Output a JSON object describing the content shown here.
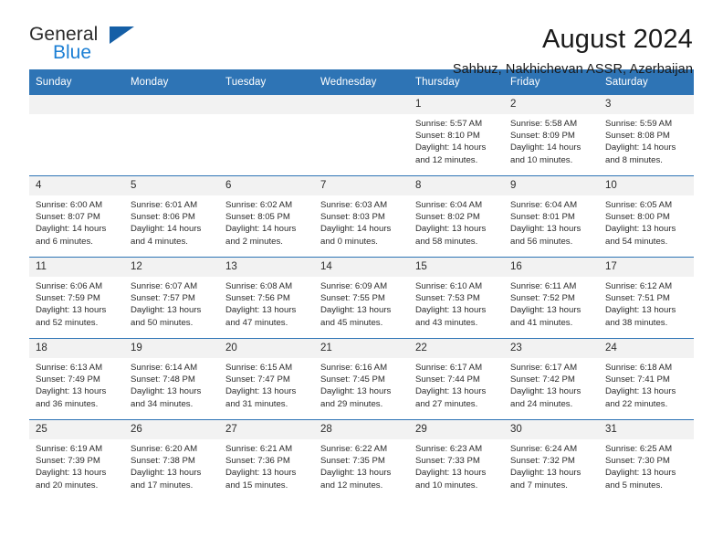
{
  "brand": {
    "name_top": "General",
    "name_bottom": "Blue",
    "triangle_color": "#155fa6",
    "blue_color": "#1c7fd4"
  },
  "header": {
    "month_title": "August 2024",
    "location": "Sahbuz, Nakhichevan ASSR, Azerbaijan"
  },
  "theme": {
    "header_bg": "#2e74b5",
    "header_text": "#ffffff",
    "daynum_bg": "#f2f2f2",
    "row_divider": "#2e74b5"
  },
  "weekdays": [
    "Sunday",
    "Monday",
    "Tuesday",
    "Wednesday",
    "Thursday",
    "Friday",
    "Saturday"
  ],
  "labels": {
    "sunrise_prefix": "Sunrise:",
    "sunset_prefix": "Sunset:",
    "daylight_prefix": "Daylight:"
  },
  "weeks": [
    [
      {
        "empty": true
      },
      {
        "empty": true
      },
      {
        "empty": true
      },
      {
        "empty": true
      },
      {
        "day": "1",
        "sunrise": "Sunrise: 5:57 AM",
        "sunset": "Sunset: 8:10 PM",
        "daylight": "Daylight: 14 hours and 12 minutes."
      },
      {
        "day": "2",
        "sunrise": "Sunrise: 5:58 AM",
        "sunset": "Sunset: 8:09 PM",
        "daylight": "Daylight: 14 hours and 10 minutes."
      },
      {
        "day": "3",
        "sunrise": "Sunrise: 5:59 AM",
        "sunset": "Sunset: 8:08 PM",
        "daylight": "Daylight: 14 hours and 8 minutes."
      }
    ],
    [
      {
        "day": "4",
        "sunrise": "Sunrise: 6:00 AM",
        "sunset": "Sunset: 8:07 PM",
        "daylight": "Daylight: 14 hours and 6 minutes."
      },
      {
        "day": "5",
        "sunrise": "Sunrise: 6:01 AM",
        "sunset": "Sunset: 8:06 PM",
        "daylight": "Daylight: 14 hours and 4 minutes."
      },
      {
        "day": "6",
        "sunrise": "Sunrise: 6:02 AM",
        "sunset": "Sunset: 8:05 PM",
        "daylight": "Daylight: 14 hours and 2 minutes."
      },
      {
        "day": "7",
        "sunrise": "Sunrise: 6:03 AM",
        "sunset": "Sunset: 8:03 PM",
        "daylight": "Daylight: 14 hours and 0 minutes."
      },
      {
        "day": "8",
        "sunrise": "Sunrise: 6:04 AM",
        "sunset": "Sunset: 8:02 PM",
        "daylight": "Daylight: 13 hours and 58 minutes."
      },
      {
        "day": "9",
        "sunrise": "Sunrise: 6:04 AM",
        "sunset": "Sunset: 8:01 PM",
        "daylight": "Daylight: 13 hours and 56 minutes."
      },
      {
        "day": "10",
        "sunrise": "Sunrise: 6:05 AM",
        "sunset": "Sunset: 8:00 PM",
        "daylight": "Daylight: 13 hours and 54 minutes."
      }
    ],
    [
      {
        "day": "11",
        "sunrise": "Sunrise: 6:06 AM",
        "sunset": "Sunset: 7:59 PM",
        "daylight": "Daylight: 13 hours and 52 minutes."
      },
      {
        "day": "12",
        "sunrise": "Sunrise: 6:07 AM",
        "sunset": "Sunset: 7:57 PM",
        "daylight": "Daylight: 13 hours and 50 minutes."
      },
      {
        "day": "13",
        "sunrise": "Sunrise: 6:08 AM",
        "sunset": "Sunset: 7:56 PM",
        "daylight": "Daylight: 13 hours and 47 minutes."
      },
      {
        "day": "14",
        "sunrise": "Sunrise: 6:09 AM",
        "sunset": "Sunset: 7:55 PM",
        "daylight": "Daylight: 13 hours and 45 minutes."
      },
      {
        "day": "15",
        "sunrise": "Sunrise: 6:10 AM",
        "sunset": "Sunset: 7:53 PM",
        "daylight": "Daylight: 13 hours and 43 minutes."
      },
      {
        "day": "16",
        "sunrise": "Sunrise: 6:11 AM",
        "sunset": "Sunset: 7:52 PM",
        "daylight": "Daylight: 13 hours and 41 minutes."
      },
      {
        "day": "17",
        "sunrise": "Sunrise: 6:12 AM",
        "sunset": "Sunset: 7:51 PM",
        "daylight": "Daylight: 13 hours and 38 minutes."
      }
    ],
    [
      {
        "day": "18",
        "sunrise": "Sunrise: 6:13 AM",
        "sunset": "Sunset: 7:49 PM",
        "daylight": "Daylight: 13 hours and 36 minutes."
      },
      {
        "day": "19",
        "sunrise": "Sunrise: 6:14 AM",
        "sunset": "Sunset: 7:48 PM",
        "daylight": "Daylight: 13 hours and 34 minutes."
      },
      {
        "day": "20",
        "sunrise": "Sunrise: 6:15 AM",
        "sunset": "Sunset: 7:47 PM",
        "daylight": "Daylight: 13 hours and 31 minutes."
      },
      {
        "day": "21",
        "sunrise": "Sunrise: 6:16 AM",
        "sunset": "Sunset: 7:45 PM",
        "daylight": "Daylight: 13 hours and 29 minutes."
      },
      {
        "day": "22",
        "sunrise": "Sunrise: 6:17 AM",
        "sunset": "Sunset: 7:44 PM",
        "daylight": "Daylight: 13 hours and 27 minutes."
      },
      {
        "day": "23",
        "sunrise": "Sunrise: 6:17 AM",
        "sunset": "Sunset: 7:42 PM",
        "daylight": "Daylight: 13 hours and 24 minutes."
      },
      {
        "day": "24",
        "sunrise": "Sunrise: 6:18 AM",
        "sunset": "Sunset: 7:41 PM",
        "daylight": "Daylight: 13 hours and 22 minutes."
      }
    ],
    [
      {
        "day": "25",
        "sunrise": "Sunrise: 6:19 AM",
        "sunset": "Sunset: 7:39 PM",
        "daylight": "Daylight: 13 hours and 20 minutes."
      },
      {
        "day": "26",
        "sunrise": "Sunrise: 6:20 AM",
        "sunset": "Sunset: 7:38 PM",
        "daylight": "Daylight: 13 hours and 17 minutes."
      },
      {
        "day": "27",
        "sunrise": "Sunrise: 6:21 AM",
        "sunset": "Sunset: 7:36 PM",
        "daylight": "Daylight: 13 hours and 15 minutes."
      },
      {
        "day": "28",
        "sunrise": "Sunrise: 6:22 AM",
        "sunset": "Sunset: 7:35 PM",
        "daylight": "Daylight: 13 hours and 12 minutes."
      },
      {
        "day": "29",
        "sunrise": "Sunrise: 6:23 AM",
        "sunset": "Sunset: 7:33 PM",
        "daylight": "Daylight: 13 hours and 10 minutes."
      },
      {
        "day": "30",
        "sunrise": "Sunrise: 6:24 AM",
        "sunset": "Sunset: 7:32 PM",
        "daylight": "Daylight: 13 hours and 7 minutes."
      },
      {
        "day": "31",
        "sunrise": "Sunrise: 6:25 AM",
        "sunset": "Sunset: 7:30 PM",
        "daylight": "Daylight: 13 hours and 5 minutes."
      }
    ]
  ]
}
